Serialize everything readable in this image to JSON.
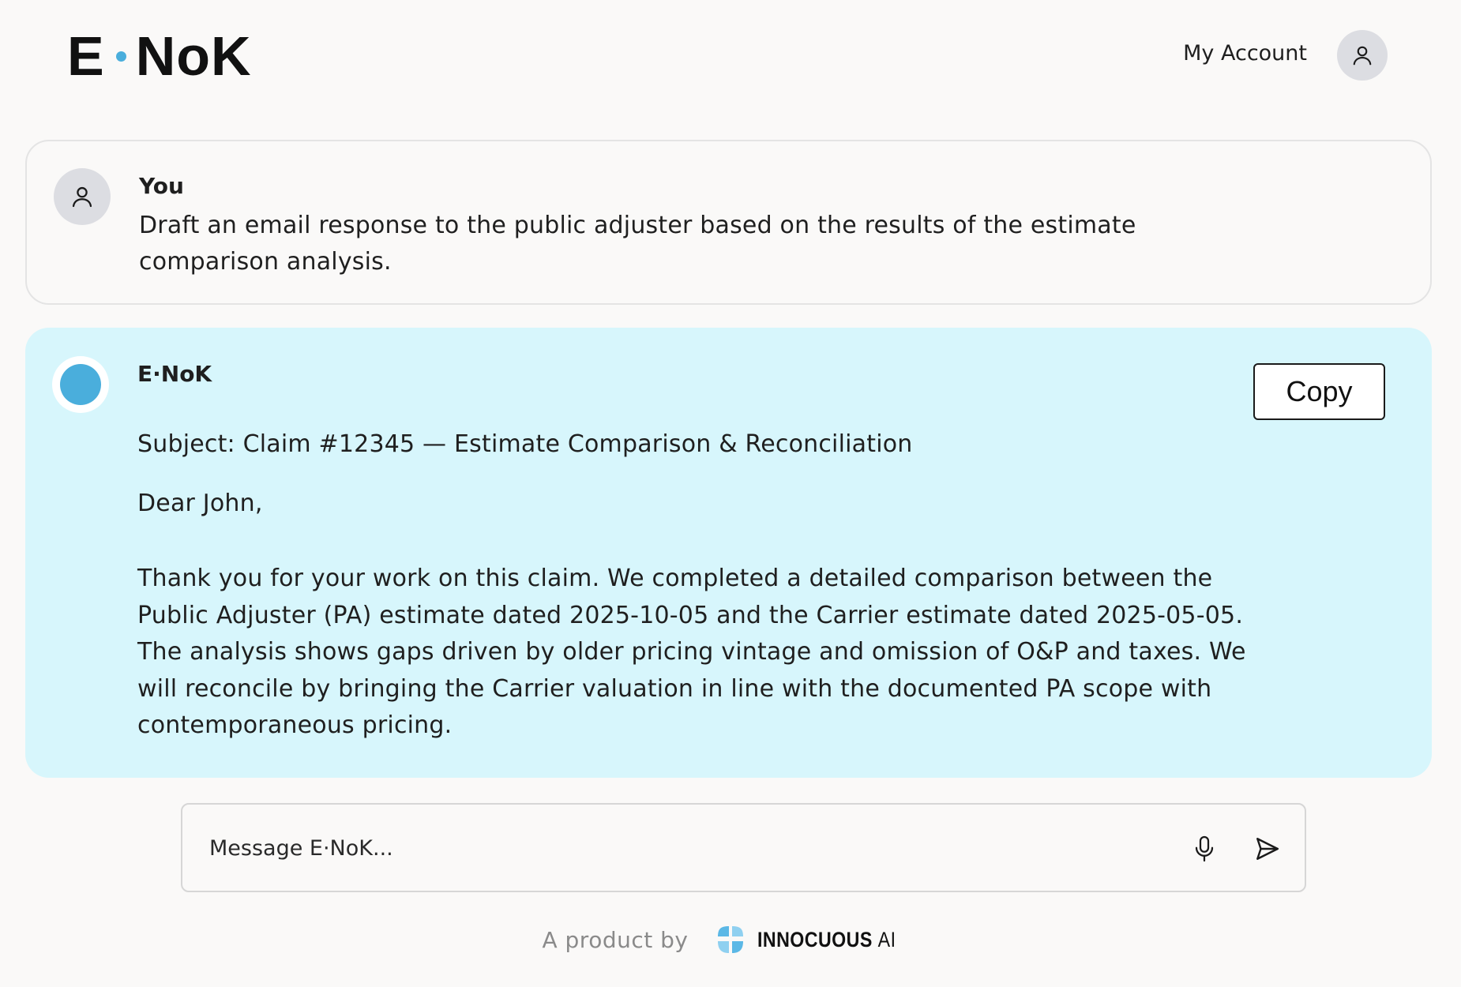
{
  "header": {
    "logo_left": "E",
    "logo_right": "NoK",
    "account_label": "My Account"
  },
  "conversation": {
    "user_message": {
      "sender": "You",
      "text": "Draft an email response to the public adjuster based on the results of the estimate comparison analysis."
    },
    "assistant_message": {
      "sender": "E·NoK",
      "copy_label": "Copy",
      "subject": "Subject: Claim #12345 — Estimate Comparison & Reconciliation",
      "greeting": "Dear John,",
      "body": "Thank you for your work on this claim. We completed a detailed comparison between the Public Adjuster (PA) estimate dated 2025-10-05 and the Carrier estimate dated 2025-05-05. The analysis shows gaps driven by older pricing vintage and omission of O&P and taxes. We will reconcile by bringing the Carrier valuation in line with the documented PA scope with contemporaneous pricing."
    }
  },
  "composer": {
    "placeholder": "Message E·NoK...",
    "value": "",
    "mic_icon": "microphone-icon",
    "send_icon": "send-icon"
  },
  "footer": {
    "product_by": "A product by",
    "brand_name": "INNOCUOUS",
    "brand_suffix": "AI"
  },
  "colors": {
    "accent": "#4aaedc",
    "assistant_card": "#d7f6fc",
    "background": "#faf9f8",
    "avatar_gray": "#dcdde2"
  }
}
